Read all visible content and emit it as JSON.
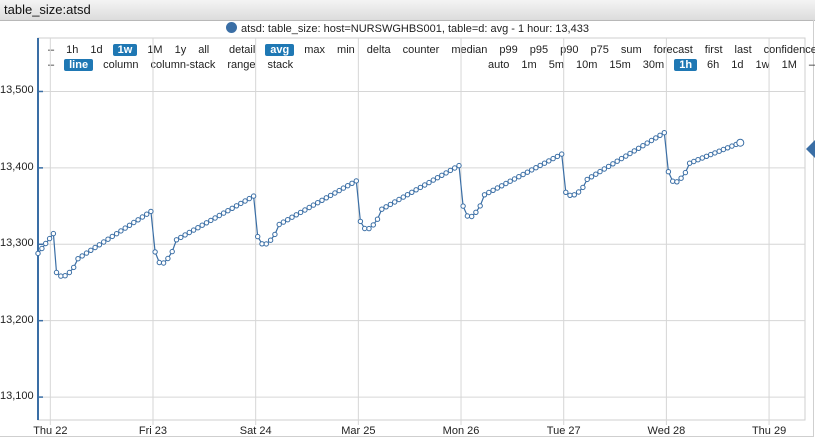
{
  "window": {
    "title": "table_size:atsd"
  },
  "legend": {
    "text": "atsd: table_size: host=NURSWGHBS001, table=d: avg - 1 hour: 13,433",
    "color": "#3a6ea5"
  },
  "toolbar": {
    "row1_left": [
      "–",
      "1h",
      "1d",
      "1w",
      "1M",
      "1y",
      "all"
    ],
    "row1_left_selected": "1w",
    "row1_right": [
      "detail",
      "avg",
      "max",
      "min",
      "delta",
      "counter",
      "median",
      "p99",
      "p95",
      "p90",
      "p75",
      "sum",
      "forecast",
      "first",
      "last",
      "confidence",
      "–"
    ],
    "row1_right_selected": "avg",
    "row2_left": [
      "–",
      "line",
      "column",
      "column-stack",
      "range",
      "stack"
    ],
    "row2_left_selected": "line",
    "row2_right": [
      "auto",
      "1m",
      "5m",
      "10m",
      "15m",
      "30m",
      "1h",
      "6h",
      "1d",
      "1w",
      "1M",
      "–"
    ],
    "row2_right_selected": "1h"
  },
  "chart_data": {
    "type": "line",
    "x_categories": [
      "Thu 22",
      "Fri 23",
      "Sat 24",
      "Mar 25",
      "Mon 26",
      "Tue 27",
      "Wed 28",
      "Thu 29"
    ],
    "y_ticks": [
      "13,500",
      "13,400",
      "13,300",
      "13,200",
      "13,100"
    ],
    "y_tick_values": [
      13500,
      13400,
      13300,
      13200,
      13100
    ],
    "ylim": [
      13070,
      13570
    ],
    "xlim": [
      -0.12,
      7.35
    ],
    "grid": true,
    "series": [
      {
        "name": "atsd: table_size: host=NURSWGHBS001, table=d: avg - 1 hour",
        "color": "#3a6ea5",
        "segments": [
          {
            "x_start": -0.12,
            "x_end": 0.03,
            "y_start": 13288,
            "y_end": 13314
          },
          {
            "x_start": 0.06,
            "x_end": 0.98,
            "y_start": 13263,
            "y_end": 13343,
            "dip_start": 13256
          },
          {
            "x_start": 1.02,
            "x_end": 1.98,
            "y_start": 13290,
            "y_end": 13363,
            "dip_start": 13273
          },
          {
            "x_start": 2.02,
            "x_end": 2.98,
            "y_start": 13310,
            "y_end": 13383,
            "dip_start": 13298
          },
          {
            "x_start": 3.02,
            "x_end": 3.98,
            "y_start": 13330,
            "y_end": 13403,
            "dip_start": 13318
          },
          {
            "x_start": 4.02,
            "x_end": 4.98,
            "y_start": 13350,
            "y_end": 13418,
            "dip_start": 13334
          },
          {
            "x_start": 5.02,
            "x_end": 5.98,
            "y_start": 13368,
            "y_end": 13446,
            "dip_start": 13362
          },
          {
            "x_start": 6.02,
            "x_end": 6.72,
            "y_start": 13395,
            "y_end": 13433,
            "dip_start": 13380
          }
        ]
      }
    ]
  }
}
